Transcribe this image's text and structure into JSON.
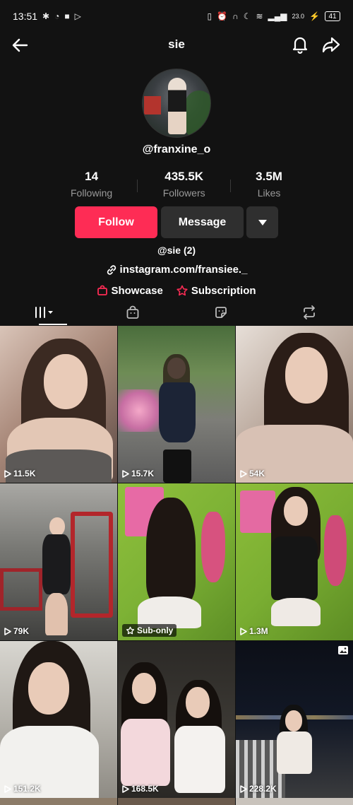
{
  "status": {
    "time": "13:51",
    "network": "23.0",
    "battery": "41"
  },
  "header": {
    "title": "sie"
  },
  "profile": {
    "handle": "@franxine_o",
    "stats": [
      {
        "value": "14",
        "label": "Following"
      },
      {
        "value": "435.5K",
        "label": "Followers"
      },
      {
        "value": "3.5M",
        "label": "Likes"
      }
    ],
    "follow_label": "Follow",
    "message_label": "Message",
    "bio_name": "@sie (2)",
    "link_text": "instagram.com/fransiee._",
    "showcase_label": "Showcase",
    "subscription_label": "Subscription"
  },
  "colors": {
    "accent": "#fe2c55",
    "background": "#121212",
    "button_dark": "#2f2f2f"
  },
  "tabs": [
    {
      "icon": "videos-grid-icon",
      "active": true
    },
    {
      "icon": "shop-bag-icon"
    },
    {
      "icon": "sticker-icon"
    },
    {
      "icon": "repost-icon"
    }
  ],
  "videos": [
    {
      "views": "11.5K"
    },
    {
      "views": "15.7K"
    },
    {
      "views": "54K"
    },
    {
      "views": "79K"
    },
    {
      "badge": "Sub-only"
    },
    {
      "views": "1.3M"
    },
    {
      "views": "151.2K"
    },
    {
      "views": "168.5K"
    },
    {
      "views": "228.2K",
      "photo": true
    }
  ]
}
